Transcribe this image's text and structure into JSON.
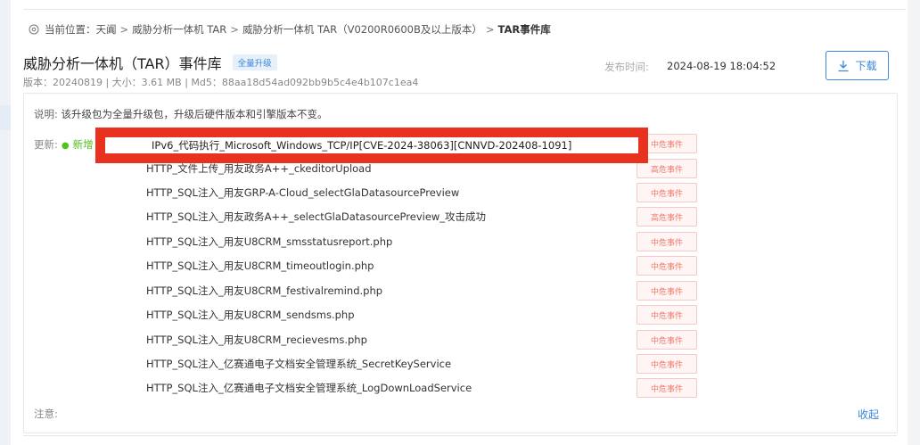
{
  "breadcrumb": {
    "prefix": "当前位置：",
    "items": [
      "天阗",
      "威胁分析一体机 TAR",
      "威胁分析一体机 TAR（V0200R0600B及以上版本）"
    ],
    "current": "TAR事件库",
    "separator": ">"
  },
  "header": {
    "title": "威胁分析一体机（TAR）事件库",
    "badge": "全量升级",
    "meta": "版本：20240819 | 大小：3.61 MB | Md5：88aa18d54ad092bb9b5c4e4b107c1ea4",
    "publish_label": "发布时间:",
    "publish_time": "2024-08-19 18:04:52",
    "download_label": "下载"
  },
  "description": {
    "label": "说明:",
    "text": "该升级包为全量升级包，升级后硬件版本和引擎版本不变。"
  },
  "updates": {
    "label": "更新:",
    "new_label": "新增",
    "highlighted_event": "IPv6_代码执行_Microsoft_Windows_TCP/IP[CVE-2024-38063][CNNVD-202408-1091]",
    "highlighted_level": "中危事件",
    "events": [
      {
        "name": "HTTP_文件上传_用友政务A++_ckeditorUpload",
        "level": "高危事件"
      },
      {
        "name": "HTTP_SQL注入_用友GRP-A-Cloud_selectGlaDatasourcePreview",
        "level": "中危事件"
      },
      {
        "name": "HTTP_SQL注入_用友政务A++_selectGlaDatasourcePreview_攻击成功",
        "level": "高危事件"
      },
      {
        "name": "HTTP_SQL注入_用友U8CRM_smsstatusreport.php",
        "level": "中危事件"
      },
      {
        "name": "HTTP_SQL注入_用友U8CRM_timeoutlogin.php",
        "level": "中危事件"
      },
      {
        "name": "HTTP_SQL注入_用友U8CRM_festivalremind.php",
        "level": "中危事件"
      },
      {
        "name": "HTTP_SQL注入_用友U8CRM_sendsms.php",
        "level": "中危事件"
      },
      {
        "name": "HTTP_SQL注入_用友U8CRM_recievesms.php",
        "level": "中危事件"
      },
      {
        "name": "HTTP_SQL注入_亿赛通电子文档安全管理系统_SecretKeyService",
        "level": "中危事件"
      },
      {
        "name": "HTTP_SQL注入_亿赛通电子文档安全管理系统_LogDownLoadService",
        "level": "中危事件"
      }
    ]
  },
  "footer": {
    "note_label": "注意:",
    "collapse_label": "收起"
  },
  "colors": {
    "accent": "#3a86d8",
    "highlight_border": "#e8321f",
    "level_text": "#f07a6b",
    "new_green": "#52c41a"
  }
}
